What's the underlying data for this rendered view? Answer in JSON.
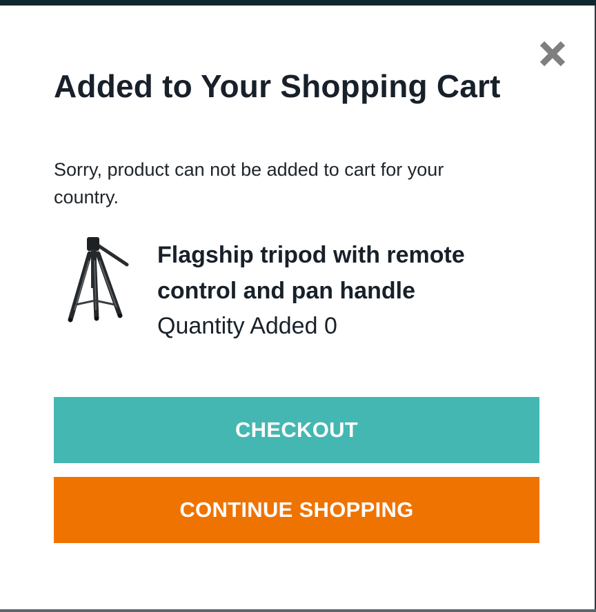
{
  "modal": {
    "title": "Added to Your Shopping Cart",
    "message": "Sorry, product can not be added to cart for your country.",
    "close_icon": "close-x-icon"
  },
  "product": {
    "name": "Flagship tripod with remote control and pan handle",
    "quantity_label": "Quantity Added",
    "quantity_value": "0",
    "image_icon": "tripod-image"
  },
  "actions": {
    "checkout_label": "CHECKOUT",
    "continue_label": "CONTINUE SHOPPING"
  },
  "colors": {
    "checkout": "#44b7b2",
    "continue": "#ef7300",
    "text": "#18202a",
    "close_icon": "#7f7f7f"
  }
}
